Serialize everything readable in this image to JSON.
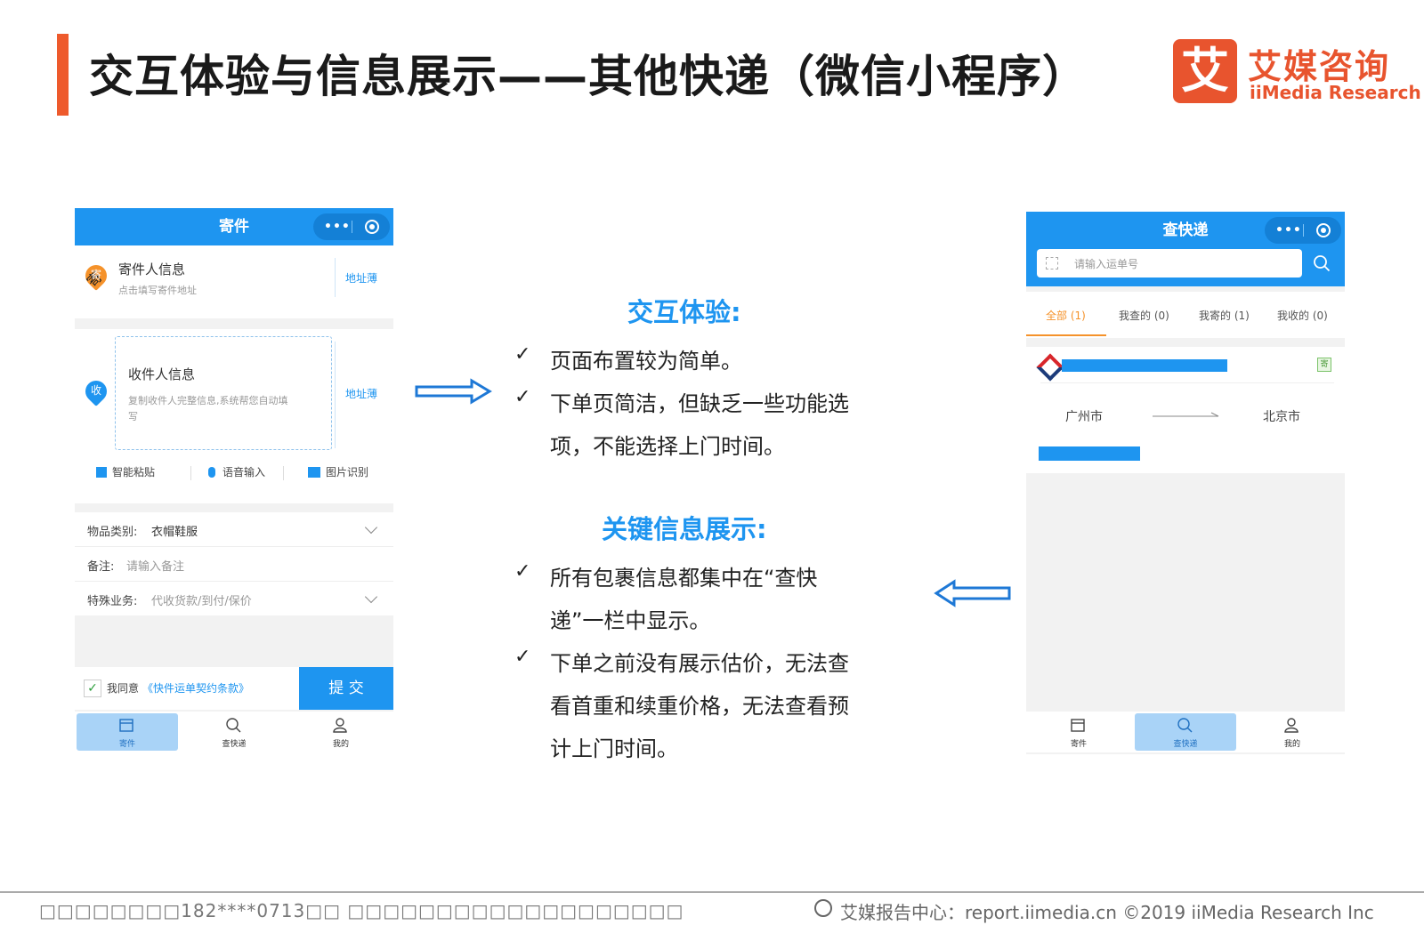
{
  "header": {
    "title": "交互体验与信息展示——其他快递（微信小程序）",
    "logo_mark": "艾",
    "logo_cn": "艾媒咨询",
    "logo_en": "iiMedia Research"
  },
  "left_phone": {
    "topbar_title": "寄件",
    "sender": {
      "badge": "寄",
      "title": "寄件人信息",
      "hint": "点击填写寄件地址",
      "address_book": "地址薄"
    },
    "receiver": {
      "badge": "收",
      "title": "收件人信息",
      "hint_line1": "复制收件人完整信息,系统帮您自动填",
      "hint_line2": "写",
      "address_book": "地址薄"
    },
    "tools": [
      "智能粘贴",
      "语音输入",
      "图片识别"
    ],
    "fields": [
      {
        "label": "物品类别:",
        "value": "衣帽鞋服"
      },
      {
        "label": "备注:",
        "value": "请输入备注"
      },
      {
        "label": "特殊业务:",
        "value": "代收货款/到付/保价"
      }
    ],
    "agree_text": "我同意",
    "agree_link": "《快件运单契约条款》",
    "submit": "提 交",
    "tabs": [
      "寄件",
      "查快递",
      "我的"
    ]
  },
  "right_phone": {
    "topbar_title": "查快递",
    "search_placeholder": "请输入运单号",
    "filter_tabs": [
      "全部 (1)",
      "我查的 (0)",
      "我寄的 (1)",
      "我收的 (0)"
    ],
    "send_badge": "寄",
    "from_city": "广州市",
    "to_city": "北京市",
    "tabs": [
      "寄件",
      "查快递",
      "我的"
    ]
  },
  "center": {
    "interaction_title": "交互体验:",
    "interaction_lines": [
      "页面布置较为简单。",
      "下单页简洁，但缺乏一些功能选",
      "项，不能选择上门时间。"
    ],
    "info_title": "关键信息展示:",
    "info_lines": [
      "所有包裹信息都集中在“查快",
      "递”一栏中显示。",
      "下单之前没有展示估价，无法查",
      "看首重和续重价格，无法查看预",
      "计上门时间。"
    ],
    "check_mark": "✓"
  },
  "footer": {
    "left": "□□□□□□□□182****0713□□ □□□□□□□□□□□□□□□□□□□",
    "right": "艾媒报告中心：report.iimedia.cn   ©2019  iiMedia Research  Inc"
  },
  "colors": {
    "accent_orange": "#ee5a2c",
    "brand_blue": "#1e95f0"
  }
}
